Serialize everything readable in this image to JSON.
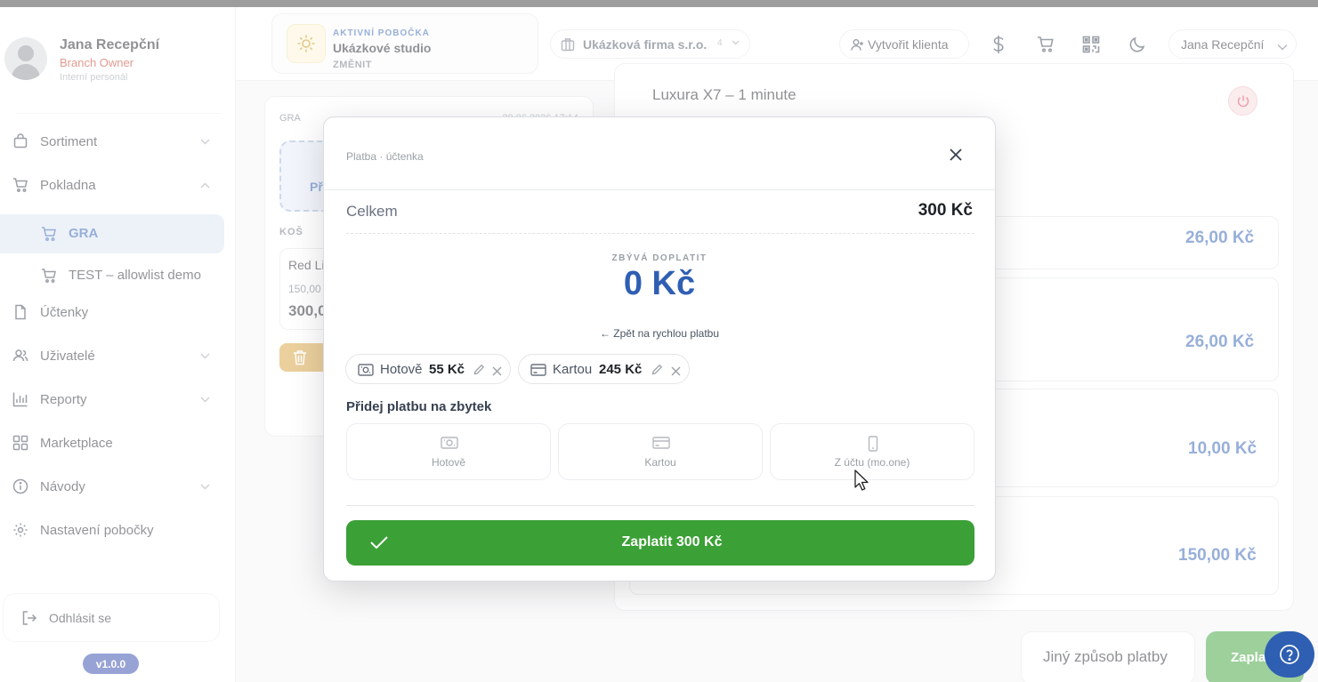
{
  "user": {
    "name": "Jana Recepční",
    "role": "Branch Owner",
    "type": "Interní personál"
  },
  "sidebar": {
    "items": [
      {
        "label": "Sortiment",
        "icon": "shopping-bag-icon",
        "expandable": true
      },
      {
        "label": "Pokladna",
        "icon": "cart-icon",
        "expandable": true,
        "expanded": true
      },
      {
        "label": "Účtenky",
        "icon": "document-icon",
        "expandable": false
      },
      {
        "label": "Uživatelé",
        "icon": "users-icon",
        "expandable": true
      },
      {
        "label": "Reporty",
        "icon": "bar-chart-icon",
        "expandable": true
      },
      {
        "label": "Marketplace",
        "icon": "grid-icon",
        "expandable": false
      },
      {
        "label": "Návody",
        "icon": "info-icon",
        "expandable": true
      },
      {
        "label": "Nastavení pobočky",
        "icon": "gear-icon",
        "expandable": false
      }
    ],
    "subitems": [
      {
        "label": "GRA",
        "active": true
      },
      {
        "label": "TEST – allowlist demo",
        "active": false
      }
    ],
    "logout": "Odhlásit se",
    "version": "v1.0.0"
  },
  "topbar": {
    "branch_kicker": "AKTIVNÍ POBOČKA",
    "branch_name": "Ukázkové studio",
    "branch_change": "ZMĚNIT",
    "firm": "Ukázková firma s.r.o.",
    "firm_count": "4",
    "create_client": "Vytvořit klienta",
    "user_menu": "Jana Recepční"
  },
  "cart": {
    "tag": "GRA",
    "date": "20.06.2026 17:14",
    "new_label": "Př",
    "basket_label": "KOŠ",
    "item_name": "Red Li",
    "item_qty": "150,00",
    "item_price": "300,0"
  },
  "products": {
    "title": "Luxura X7 – 1 minute",
    "prices": [
      "26,00 Kč",
      "26,00 Kč",
      "10,00 Kč",
      "150,00 Kč"
    ]
  },
  "footer": {
    "alt_payment": "Jiný způsob platby",
    "pay": "Zapla"
  },
  "modal": {
    "breadcrumb": "Platba · účtenka",
    "total_label": "Celkem",
    "total_value": "300 Kč",
    "remaining_label": "ZBÝVÁ DOPLATIT",
    "remaining_value": "0 Kč",
    "back_link": "← Zpět na rychlou platbu",
    "payments": [
      {
        "method": "Hotově",
        "amount": "55 Kč",
        "icon": "cash-icon"
      },
      {
        "method": "Kartou",
        "amount": "245 Kč",
        "icon": "card-icon"
      }
    ],
    "add_label": "Přidej platbu na zbytek",
    "methods": [
      {
        "label": "Hotově",
        "icon": "cash-icon"
      },
      {
        "label": "Kartou",
        "icon": "card-icon"
      },
      {
        "label": "Z účtu (mo.one)",
        "icon": "phone-icon"
      }
    ],
    "confirm": "Zaplatit 300 Kč"
  },
  "colors": {
    "accent": "#2f5fb3",
    "success": "#3ba036",
    "danger": "#c2331f"
  }
}
